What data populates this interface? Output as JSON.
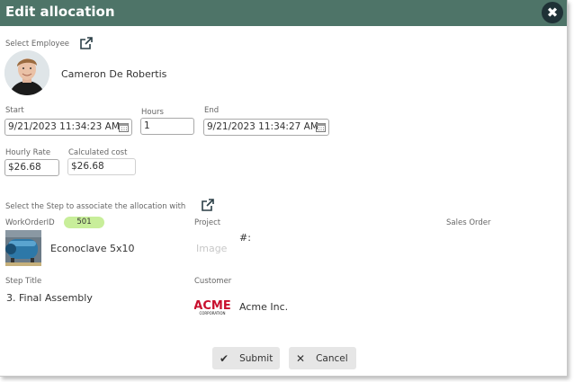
{
  "dialog": {
    "title": "Edit allocation",
    "close_label": "✖"
  },
  "employee": {
    "label": "Select Employee",
    "name": "Cameron De Robertis"
  },
  "start": {
    "label": "Start",
    "value": "9/21/2023 11:34:23 AM"
  },
  "hours": {
    "label": "Hours",
    "value": "1"
  },
  "end": {
    "label": "End",
    "value": "9/21/2023 11:34:27 AM"
  },
  "hourly_rate": {
    "label": "Hourly Rate",
    "value": "$26.68"
  },
  "calculated_cost": {
    "label": "Calculated cost",
    "value": "$26.68"
  },
  "step_select": {
    "label": "Select the Step to associate the allocation with"
  },
  "work_order": {
    "label": "WorkOrderID",
    "id": "501",
    "name": "Econoclave 5x10"
  },
  "project": {
    "label": "Project",
    "image_placeholder": "Image",
    "number_prefix": "#:"
  },
  "sales_order": {
    "label": "Sales Order"
  },
  "step_title": {
    "label": "Step Title",
    "value": "3. Final Assembly"
  },
  "customer": {
    "label": "Customer",
    "name": "Acme Inc.",
    "logo_text": "ACME",
    "logo_subtext": "CORPORATION"
  },
  "actions": {
    "submit_label": "Submit",
    "cancel_label": "Cancel"
  },
  "colors": {
    "header": "#4e7468",
    "close_button": "#1f3136",
    "badge": "#c8ee9a",
    "button": "#e6e6e6"
  }
}
